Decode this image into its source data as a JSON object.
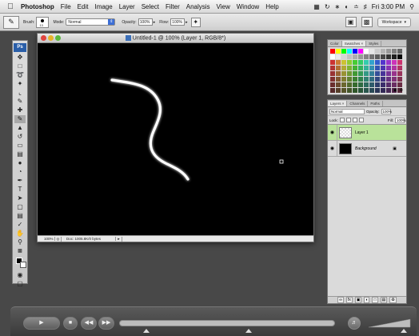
{
  "menubar": {
    "app": "Photoshop",
    "items": [
      "File",
      "Edit",
      "Image",
      "Layer",
      "Select",
      "Filter",
      "Analysis",
      "View",
      "Window",
      "Help"
    ],
    "clock": "Fri 3:00 PM"
  },
  "options": {
    "brush_label": "Brush:",
    "brush_size": "13",
    "mode_label": "Mode:",
    "mode_value": "Normal",
    "opacity_label": "Opacity:",
    "opacity_value": "100%",
    "flow_label": "Flow:",
    "flow_value": "100%",
    "workspace_label": "Workspace"
  },
  "toolbox": {
    "logo": "Ps"
  },
  "document": {
    "title": "Untitled-1 @ 100% (Layer 1, RGB/8*)",
    "zoom": "100%",
    "doc_info": "Doc: 1005.8K/0 bytes"
  },
  "swatches_panel": {
    "tabs": [
      "Color",
      "Swatches ×",
      "Styles"
    ]
  },
  "layers_panel": {
    "tabs": [
      "Layers ×",
      "Channels",
      "Paths"
    ],
    "blend_mode": "Normal",
    "opacity_label": "Opacity:",
    "opacity_value": "100%",
    "lock_label": "Lock:",
    "fill_label": "Fill:",
    "fill_value": "100%",
    "layers": [
      {
        "name": "Layer 1"
      },
      {
        "name": "Background"
      }
    ]
  }
}
